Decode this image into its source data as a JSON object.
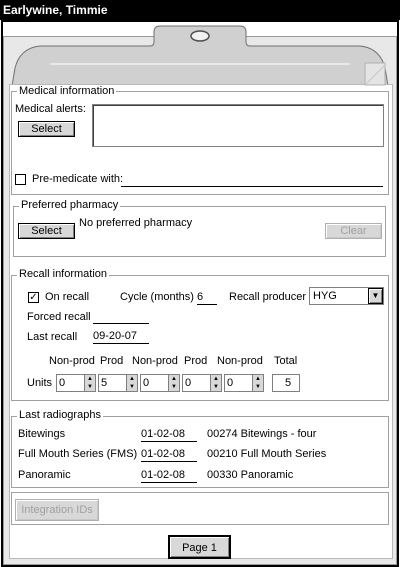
{
  "window": {
    "title": "Earlywine, Timmie"
  },
  "medical": {
    "legend": "Medical information",
    "alerts_label": "Medical alerts:",
    "select_label": "Select",
    "alerts_text": "",
    "premedicate_label": "Pre-medicate with:",
    "premedicate_value": ""
  },
  "pharmacy": {
    "legend": "Preferred pharmacy",
    "select_label": "Select",
    "text": "No preferred pharmacy",
    "clear_label": "Clear"
  },
  "recall": {
    "legend": "Recall information",
    "on_recall_label": "On recall",
    "on_recall_checked": true,
    "cycle_label": "Cycle (months)",
    "cycle_value": "6",
    "producer_label": "Recall producer",
    "producer_value": "HYG",
    "forced_label": "Forced recall",
    "forced_value": "",
    "last_label": "Last recall",
    "last_value": "09-20-07",
    "units_label": "Units",
    "headers": [
      "Non-prod",
      "Prod",
      "Non-prod",
      "Prod",
      "Non-prod",
      "Total"
    ],
    "units": [
      "0",
      "5",
      "0",
      "0",
      "0"
    ],
    "total": "5"
  },
  "radiographs": {
    "legend": "Last radiographs",
    "rows": [
      {
        "label": "Bitewings",
        "date": "01-02-08",
        "desc": "00274 Bitewings - four"
      },
      {
        "label": "Full Mouth Series (FMS)",
        "date": "01-02-08",
        "desc": "00210 Full Mouth Series"
      },
      {
        "label": "Panoramic",
        "date": "01-02-08",
        "desc": "00330 Panoramic"
      }
    ]
  },
  "integration_label": "Integration IDs",
  "page_label": "Page 1"
}
